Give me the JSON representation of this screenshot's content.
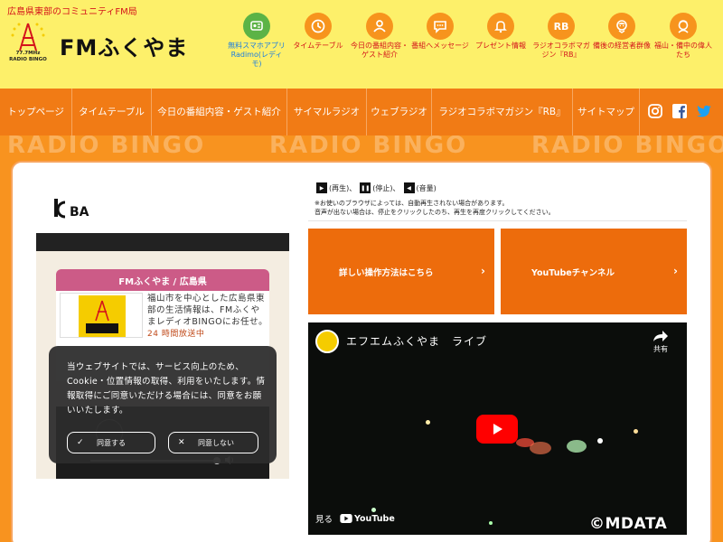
{
  "header": {
    "tagline": "広島県東部のコミュニティFM局",
    "brand": "FMふくやま",
    "logo_subtext": "77.7MHz RADIO BINGO",
    "nav": [
      {
        "label": "無料スマホアプリ Radimo(レディモ)",
        "icon": "radimo-app-icon"
      },
      {
        "label": "タイムテーブル",
        "icon": "clock-icon"
      },
      {
        "label": "今日の番組内容・ゲスト紹介",
        "icon": "person-icon"
      },
      {
        "label": "番組へメッセージ",
        "icon": "chat-bubble-icon"
      },
      {
        "label": "プレゼント情報",
        "icon": "bell-icon"
      },
      {
        "label": "ラジオコラボマガジン『RB』",
        "icon": "rb-icon",
        "icon_text": "RB"
      },
      {
        "label": "備後の経営者群像",
        "icon": "boss-icon"
      },
      {
        "label": "福山・備中の偉人たち",
        "icon": "historical-figure-icon"
      }
    ]
  },
  "main_nav": {
    "items": [
      "トップページ",
      "タイムテーブル",
      "今日の番組内容・ゲスト紹介",
      "サイマルラジオ",
      "ウェブラジオ",
      "ラジオコラボマガジン『RB』",
      "サイトマップ"
    ],
    "social": [
      "instagram-icon",
      "facebook-icon",
      "twitter-icon"
    ]
  },
  "band": {
    "text": "RADIO BINGO"
  },
  "left": {
    "jcba_logo": "JCBA",
    "station_header": "FMふくやま / 広島県",
    "station_logo_text": "77.7MHz RADIO BINGO",
    "station_desc": "福山市を中心とした広島県東部の生活情報は、FMふくやまレディオBINGOにお任せ。",
    "station_status": "24 時間放送中",
    "cookie": {
      "text": "当ウェブサイトでは、サービス向上のため、Cookie・位置情報の取得、利用をいたします。情報取得にご同意いただける場合には、同意をお願いいたします。",
      "agree": "同意する",
      "disagree": "同意しない"
    }
  },
  "right": {
    "legend": {
      "play": "(再生)、",
      "stop": "(停止)、",
      "volume": "(音量)"
    },
    "note1": "※お使いのブラウザによっては、自動再生されない場合があります。",
    "note2": "音声が出ない場合は、停止をクリックしたのち、再生を再度クリックしてください。",
    "btn_howto": "詳しい操作方法はこちら",
    "btn_youtube": "YouTubeチャンネル",
    "video": {
      "title": "エフエムふくやま　ライブ",
      "share": "共有",
      "watch_on": "見る",
      "youtube": "YouTube"
    }
  },
  "watermark": "©MDATA",
  "colors": {
    "header_bg": "#fdf06a",
    "nav_bg": "#f17b15",
    "accent_orange": "#ed6c0c",
    "station_pink": "#cc5b87",
    "youtube_red": "#ff0000"
  }
}
